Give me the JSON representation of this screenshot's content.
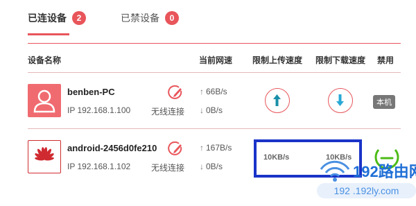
{
  "tabs": [
    {
      "label": "已连设备",
      "count": "2"
    },
    {
      "label": "已禁设备",
      "count": "0"
    }
  ],
  "columns": {
    "device_name": "设备名称",
    "current_speed": "当前网速",
    "upload_limit": "限制上传速度",
    "download_limit": "限制下载速度",
    "block": "禁用"
  },
  "devices": [
    {
      "name": "benben-PC",
      "ip": "IP 192.168.1.100",
      "connection": "无线连接",
      "up_speed": "66B/s",
      "down_speed": "0B/s",
      "avatar_icon": "user-icon",
      "self_label": "本机"
    },
    {
      "name": "android-2456d0fe210",
      "ip": "IP 192.168.1.102",
      "connection": "无线连接",
      "up_speed": "167B/s",
      "down_speed": "0B/s",
      "avatar_icon": "huawei-logo",
      "upload_limit": "10KB/s",
      "download_limit": "10KB/s"
    }
  ],
  "watermark": {
    "brand": "192路由网",
    "url": "192 .192ly.com"
  },
  "colors": {
    "accent": "#e8555a",
    "highlight": "#1a33c8",
    "arrow_up": "#1a8fa8",
    "arrow_down": "#27a9d6",
    "toggle": "#4cbb17"
  }
}
